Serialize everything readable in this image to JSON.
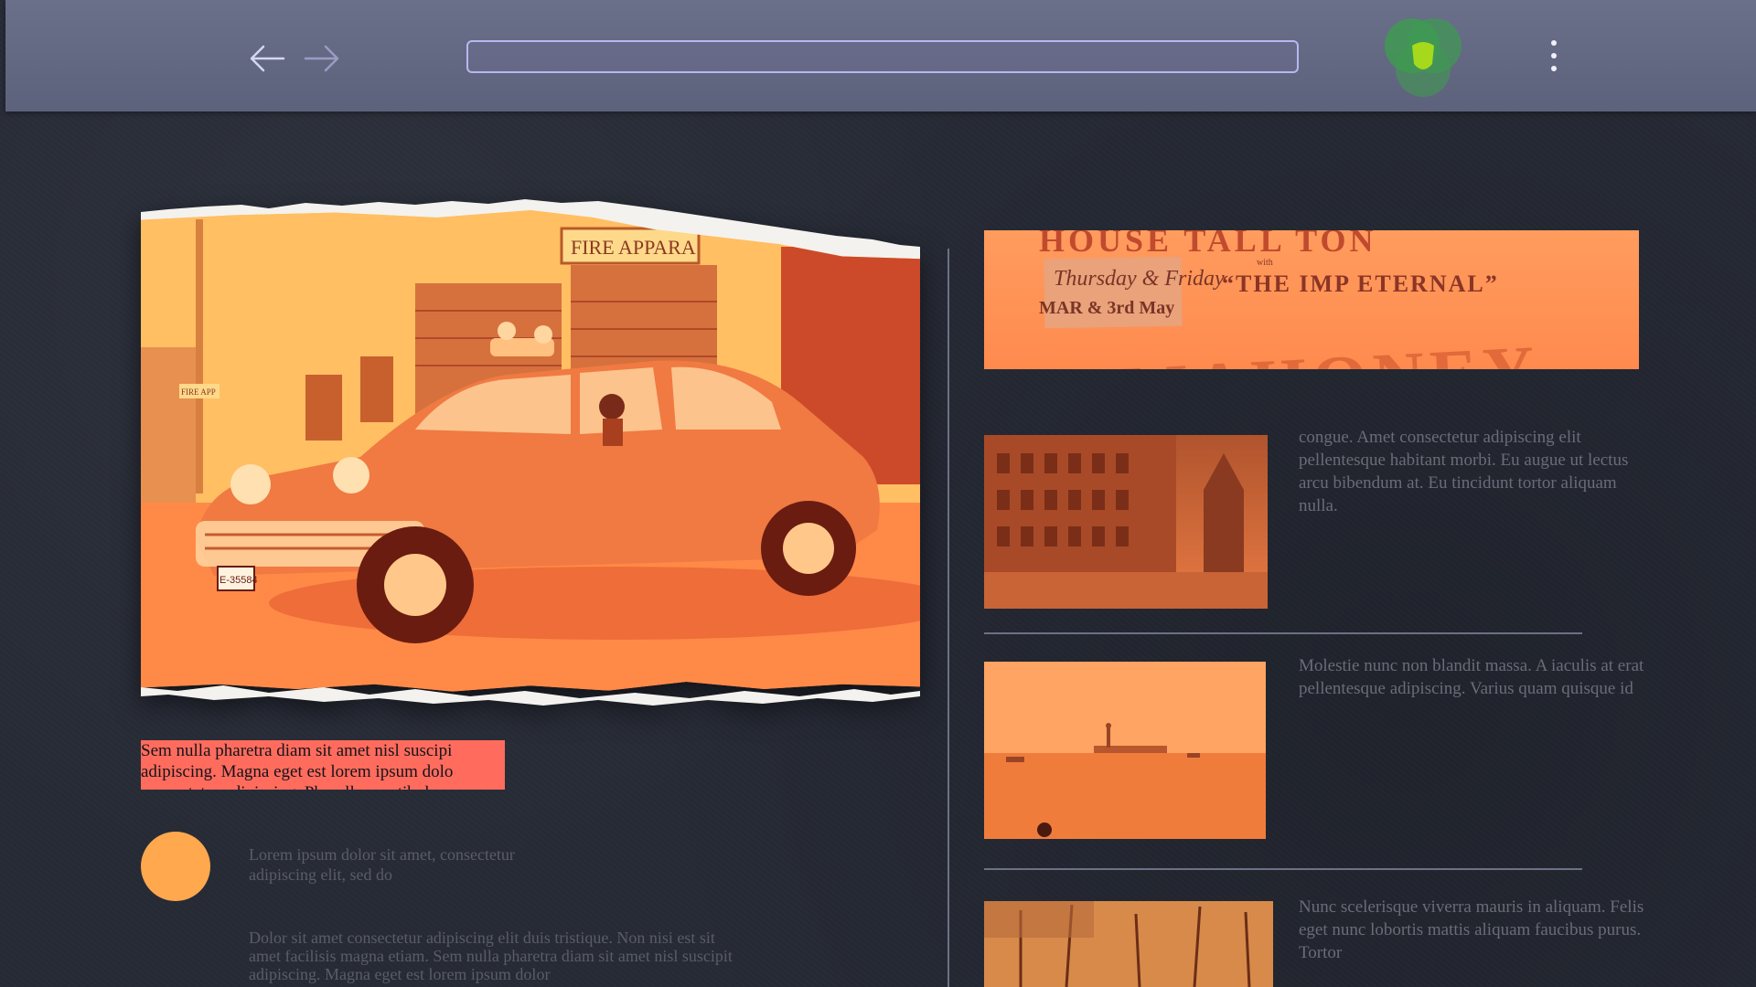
{
  "browser": {
    "back_icon": "arrow-left-icon",
    "forward_icon": "arrow-right-icon",
    "address_bar": {
      "value": "",
      "placeholder": ""
    },
    "extension_icon": "shield-logo-icon",
    "menu_icon": "kebab-menu-icon",
    "accent_color": "#b7b8f0",
    "toolbar_color": "#6a6f8a"
  },
  "hero": {
    "photo_sign": "FIRE APPARA",
    "small_sign": "FIRE APP",
    "plate": "E-35584",
    "photo_tint": "#ff9e4a"
  },
  "left_column": {
    "highlight_text": [
      "Sem nulla pharetra diam sit amet nisl suscipi",
      "adipiscing. Magna eget est lorem ipsum dolo",
      "consectetur adipiscing. Phasellus vestibulum"
    ],
    "highlight_color": "#ff6c5e",
    "lead": "Lorem ipsum dolor sit amet, consectetur adipiscing elit, sed do",
    "body": "Dolor sit amet consectetur adipiscing elit duis tristique. Non nisi est sit amet facilisis magna etiam. Sem nulla pharetra diam sit amet nisl suscipit adipiscing. Magna eget est lorem ipsum dolor"
  },
  "banner": {
    "top": "HOUSE TALL TON",
    "date_line1": "Thursday & Friday",
    "date_line2": "MAR & 3rd May",
    "with": "with",
    "title": "“THE IMP ETERNAL”",
    "headline": "MAHONEY"
  },
  "articles": [
    {
      "text": "congue. Amet consectetur adipiscing elit pellentesque habitant morbi. Eu augue ut lectus arcu bibendum at. Eu tincidunt tortor aliquam nulla."
    },
    {
      "text": "Molestie nunc non blandit massa. A iaculis at erat pellentesque adipiscing. Varius quam quisque id"
    },
    {
      "text": "Nunc scelerisque viverra mauris in aliquam. Felis eget nunc lobortis mattis aliquam faucibus purus. Tortor"
    }
  ]
}
